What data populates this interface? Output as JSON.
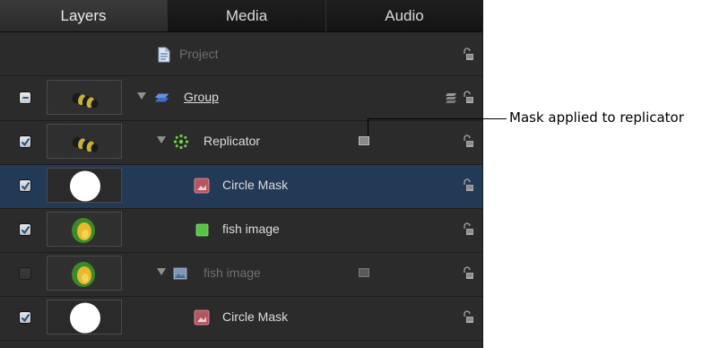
{
  "tabs": [
    {
      "label": "Layers",
      "active": true
    },
    {
      "label": "Media",
      "active": false
    },
    {
      "label": "Audio",
      "active": false
    }
  ],
  "project": {
    "label": "Project"
  },
  "rows": [
    {
      "name": "Group",
      "checkbox": "mixed",
      "thumbnail": "caterpillar",
      "icon": "group-icon",
      "disclosure": true,
      "underline": true
    },
    {
      "name": "Replicator",
      "checkbox": "checked",
      "thumbnail": "caterpillar",
      "icon": "replicator-icon",
      "disclosure": true,
      "mask_indicator": true
    },
    {
      "name": "Circle Mask",
      "checkbox": "checked",
      "thumbnail": "white-circle",
      "icon": "image-mask-icon",
      "selected": true
    },
    {
      "name": "fish image",
      "checkbox": "checked",
      "thumbnail": "fish",
      "icon": "green-square-icon"
    },
    {
      "name": "fish image",
      "checkbox": "unchecked",
      "thumbnail": "fish",
      "icon": "image-icon",
      "disclosure": true,
      "mask_indicator": true,
      "dimmed": true
    },
    {
      "name": "Circle Mask",
      "checkbox": "checked",
      "thumbnail": "white-circle",
      "icon": "image-mask-icon"
    }
  ],
  "callout": {
    "text": "Mask applied to replicator"
  },
  "colors": {
    "panel_bg": "#2b2b2b",
    "selected_row": "#233a56",
    "tab_bar": "#141414"
  }
}
